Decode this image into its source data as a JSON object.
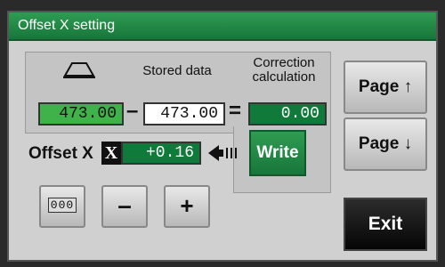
{
  "window": {
    "title": "Offset X setting"
  },
  "panel": {
    "stored_label": "Stored data",
    "correction_label_line1": "Correction",
    "correction_label_line2": "calculation",
    "current_value": "473.00",
    "stored_value": "473.00",
    "correction_value": "0.00",
    "minus_op": "–",
    "equals_op": "="
  },
  "offset": {
    "label": "Offset X",
    "x_badge": "X",
    "value": "+0.16"
  },
  "buttons": {
    "write": "Write",
    "page_up": "Page ↑",
    "page_down": "Page ↓",
    "counter": "000",
    "minus": "–",
    "plus": "+",
    "exit": "Exit"
  },
  "colors": {
    "title_green": "#17763a",
    "field_green": "#3fb34a",
    "dark_green": "#0f7a3a"
  }
}
